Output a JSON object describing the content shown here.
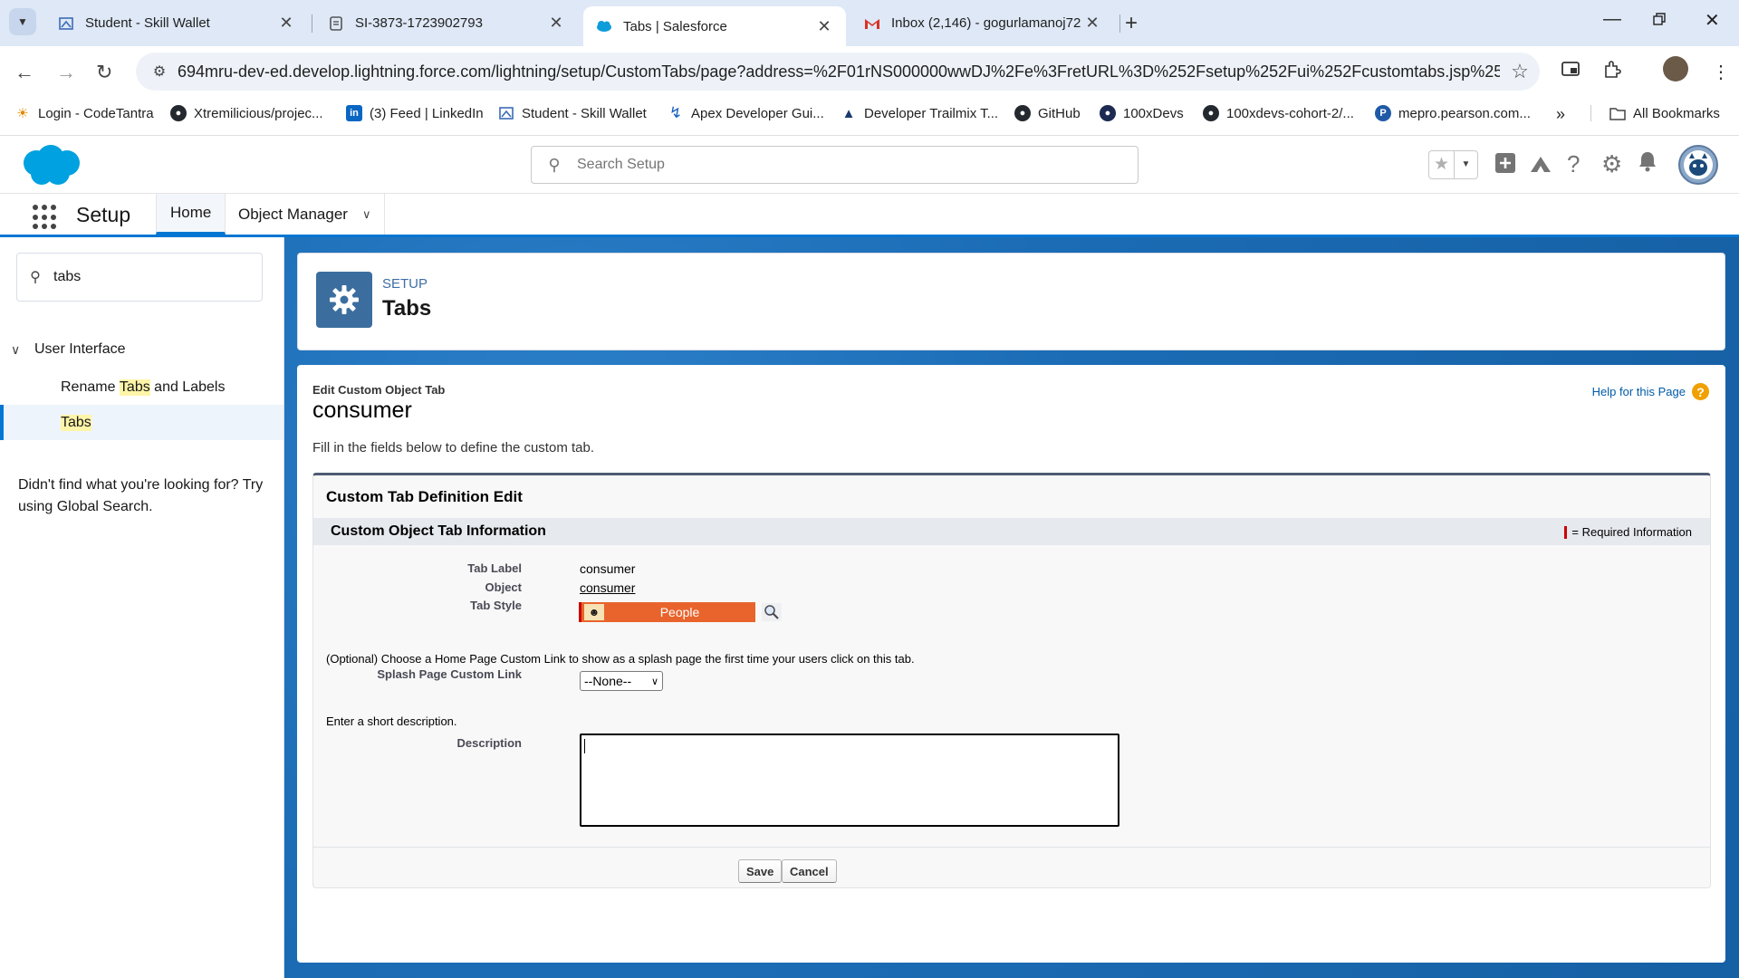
{
  "browser": {
    "tabs": [
      {
        "title": "Student - Skill Wallet",
        "icon": "skill-wallet-icon"
      },
      {
        "title": "SI-3873-1723902793",
        "icon": "doc-icon"
      },
      {
        "title": "Tabs | Salesforce",
        "icon": "salesforce-cloud-icon"
      },
      {
        "title": "Inbox (2,146) - gogurlamanoj72",
        "icon": "gmail-icon"
      }
    ],
    "url": "694mru-dev-ed.develop.lightning.force.com/lightning/setup/CustomTabs/page?address=%2F01rNS000000wwDJ%2Fe%3FretURL%3D%252Fsetup%252Fui%252Fcustomtabs.jsp%253Fset...",
    "bookmarks": [
      "Login - CodeTantra",
      "Xtremilicious/projec...",
      "(3) Feed | LinkedIn",
      "Student - Skill Wallet",
      "Apex Developer Gui...",
      "Developer Trailmix T...",
      "GitHub",
      "100xDevs",
      "100xdevs-cohort-2/...",
      "mepro.pearson.com...",
      "All Bookmarks"
    ]
  },
  "sf": {
    "search_placeholder": "Search Setup",
    "app_name": "Setup",
    "nav_home": "Home",
    "nav_object_manager": "Object Manager"
  },
  "sidebar": {
    "quickfind_value": "tabs",
    "group": "User Interface",
    "item1_prefix": "Rename ",
    "item1_hl": "Tabs",
    "item1_suffix": " and Labels",
    "item2": "Tabs",
    "hint": "Didn't find what you're looking for? Try using Global Search."
  },
  "header": {
    "eyebrow": "SETUP",
    "title": "Tabs"
  },
  "page": {
    "eyebrow": "Edit Custom Object Tab",
    "title": "consumer",
    "help": "Help for this Page",
    "intro": "Fill in the fields below to define the custom tab.",
    "block_title": "Custom Tab Definition Edit",
    "section_title": "Custom Object Tab Information",
    "required_info": "= Required Information",
    "tab_label_lbl": "Tab Label",
    "tab_label_val": "consumer",
    "object_lbl": "Object",
    "object_val": "consumer",
    "tab_style_lbl": "Tab Style",
    "tab_style_val": "People",
    "splash_note": "(Optional) Choose a Home Page Custom Link to show as a splash page the first time your users click on this tab.",
    "splash_lbl": "Splash Page Custom Link",
    "splash_val": "--None--",
    "desc_note": "Enter a short description.",
    "desc_lbl": "Description",
    "desc_val": "",
    "save": "Save",
    "cancel": "Cancel"
  },
  "colors": {
    "brand": "#0176d3",
    "tab_style": "#e8642c"
  }
}
